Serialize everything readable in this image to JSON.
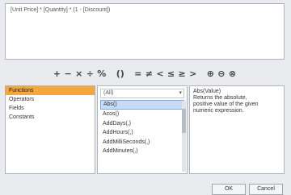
{
  "editor": {
    "expression": "[Unit Price] * [Quantity] * (1 - [Discount])"
  },
  "toolbar": {
    "operators": [
      "+",
      "−",
      "×",
      "÷",
      "%",
      "()",
      "=",
      "≠",
      "<",
      "≤",
      "≥",
      ">",
      "⊕",
      "⊖",
      "⊗"
    ]
  },
  "categories": {
    "items": [
      "Functions",
      "Operators",
      "Fields",
      "Constants"
    ],
    "selected": "Functions"
  },
  "functions": {
    "filter_value": "(All)",
    "items": [
      "Abs()",
      "Acos()",
      "AddDays(,)",
      "AddHours(,)",
      "AddMilliSeconds(,)",
      "AddMinutes(,)"
    ],
    "selected": "Abs()"
  },
  "description": {
    "lines": [
      "Abs(Value)",
      "Returns the absolute,",
      "positive value of the given",
      "numeric expression."
    ]
  },
  "buttons": {
    "ok": "OK",
    "cancel": "Cancel"
  }
}
